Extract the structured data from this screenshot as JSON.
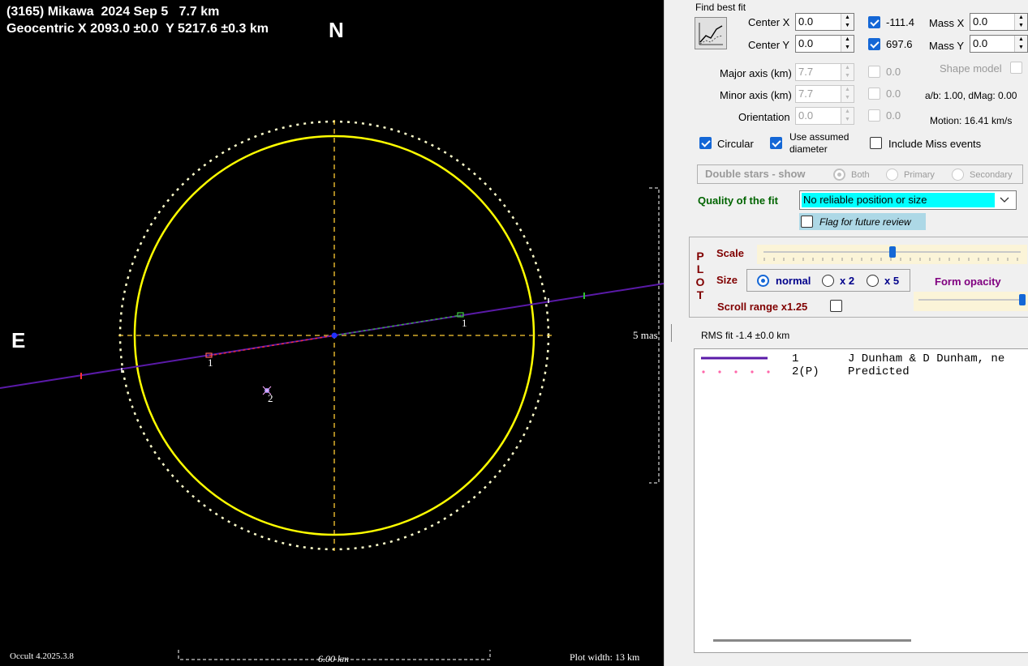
{
  "plot": {
    "title_line1": "(3165) Mikawa  2024 Sep 5   7.7 km",
    "title_line2": "Geocentric X 2093.0 ±0.0  Y 5217.6 ±0.3 km",
    "north_label": "N",
    "east_label": "E",
    "chord1_label": "1",
    "chord1_end_label": "1",
    "star2_label": "2",
    "scale_bar_label": "5 mas",
    "distance_label": "6.00 km",
    "version_label": "Occult 4.2025.3.8",
    "plot_width_label": "Plot width: 13 km",
    "colors": {
      "ellipse": "#ffff00",
      "chord": "#5a1aa8",
      "axes": "#ffcc33"
    }
  },
  "fit": {
    "group_label": "Find best fit",
    "fit_icon": "chart-line-icon",
    "center_x_label": "Center X",
    "center_x_value": "0.0",
    "center_y_label": "Center Y",
    "center_y_value": "0.0",
    "center_x_result": "-111.4",
    "center_y_result": "697.6",
    "mass_x_label": "Mass X",
    "mass_x_value": "0.0",
    "mass_y_label": "Mass Y",
    "mass_y_value": "0.0",
    "major_axis_label": "Major axis (km)",
    "major_axis_value": "7.7",
    "major_axis_result": "0.0",
    "minor_axis_label": "Minor axis (km)",
    "minor_axis_value": "7.7",
    "minor_axis_result": "0.0",
    "orientation_label": "Orientation",
    "orientation_value": "0.0",
    "orientation_result": "0.0",
    "shape_model_label": "Shape model",
    "ab_dmag": "a/b: 1.00, dMag: 0.00",
    "motion": "Motion: 16.41 km/s",
    "circular_label": "Circular",
    "use_assumed_label_1": "Use assumed",
    "use_assumed_label_2": "diameter",
    "include_miss_label": "Include Miss events"
  },
  "double_stars": {
    "label": "Double stars - show",
    "both": "Both",
    "primary": "Primary",
    "secondary": "Secondary"
  },
  "quality": {
    "label": "Quality of the fit",
    "value": "No reliable position or size",
    "flag_label": "Flag for future review"
  },
  "plot_controls": {
    "side_letters": [
      "P",
      "L",
      "O",
      "T"
    ],
    "scale_label": "Scale",
    "scale_level": 0.5,
    "size_label": "Size",
    "size_normal": "normal",
    "size_x2": "x 2",
    "size_x5": "x 5",
    "form_opacity_label": "Form opacity",
    "form_opacity_level": 1.0,
    "scroll_range_label": "Scroll range x1.25"
  },
  "rms": "RMS fit -1.4 ±0.0 km",
  "legend": {
    "rows": [
      {
        "num": "1",
        "text": "J Dunham & D Dunham, ne"
      },
      {
        "num": "2(P)",
        "text": "Predicted"
      }
    ]
  }
}
